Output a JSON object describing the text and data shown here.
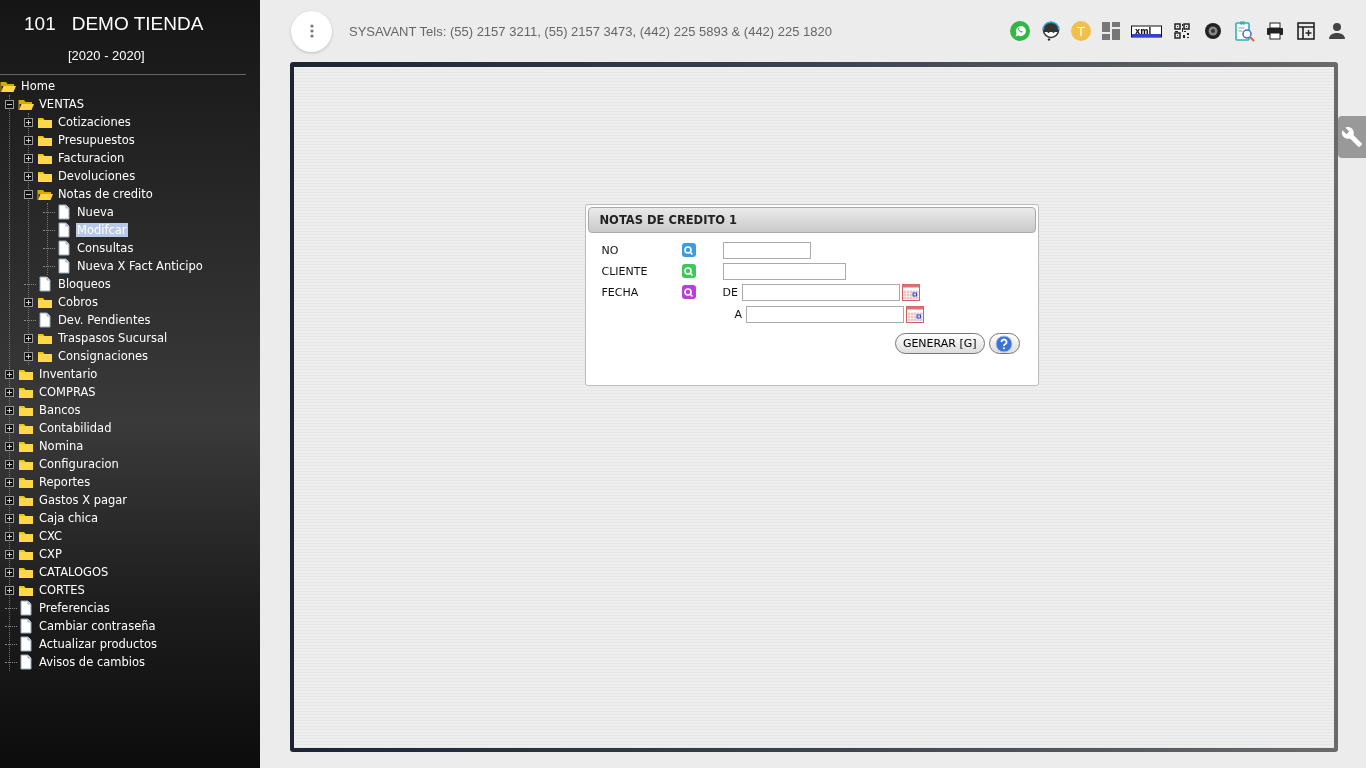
{
  "sidebar": {
    "company_number": "101",
    "company_name": "DEMO TIENDA",
    "period": "[2020 - 2020]",
    "tree": [
      {
        "label": "Home",
        "kind": "folder",
        "expanded": true,
        "selected": false,
        "children": [
          {
            "label": "VENTAS",
            "kind": "folder",
            "expanded": true,
            "selected": false,
            "children": [
              {
                "label": "Cotizaciones",
                "kind": "folder",
                "expanded": false,
                "selected": false
              },
              {
                "label": "Presupuestos",
                "kind": "folder",
                "expanded": false,
                "selected": false
              },
              {
                "label": "Facturacion",
                "kind": "folder",
                "expanded": false,
                "selected": false
              },
              {
                "label": "Devoluciones",
                "kind": "folder",
                "expanded": false,
                "selected": false
              },
              {
                "label": "Notas de credito",
                "kind": "folder",
                "expanded": true,
                "selected": false,
                "children": [
                  {
                    "label": "Nueva",
                    "kind": "page",
                    "selected": false
                  },
                  {
                    "label": "Modifcar",
                    "kind": "page",
                    "selected": true
                  },
                  {
                    "label": "Consultas",
                    "kind": "page",
                    "selected": false
                  },
                  {
                    "label": "Nueva X Fact Anticipo",
                    "kind": "page",
                    "selected": false
                  }
                ]
              },
              {
                "label": "Bloqueos",
                "kind": "page",
                "selected": false
              },
              {
                "label": "Cobros",
                "kind": "folder",
                "expanded": false,
                "selected": false
              },
              {
                "label": "Dev. Pendientes",
                "kind": "page",
                "selected": false
              },
              {
                "label": "Traspasos Sucursal",
                "kind": "folder",
                "expanded": false,
                "selected": false
              },
              {
                "label": "Consignaciones",
                "kind": "folder",
                "expanded": false,
                "selected": false
              }
            ]
          },
          {
            "label": "Inventario",
            "kind": "folder",
            "expanded": false,
            "selected": false
          },
          {
            "label": "COMPRAS",
            "kind": "folder",
            "expanded": false,
            "selected": false
          },
          {
            "label": "Bancos",
            "kind": "folder",
            "expanded": false,
            "selected": false
          },
          {
            "label": "Contabilidad",
            "kind": "folder",
            "expanded": false,
            "selected": false
          },
          {
            "label": "Nomina",
            "kind": "folder",
            "expanded": false,
            "selected": false
          },
          {
            "label": "Configuracion",
            "kind": "folder",
            "expanded": false,
            "selected": false
          },
          {
            "label": "Reportes",
            "kind": "folder",
            "expanded": false,
            "selected": false
          },
          {
            "label": "Gastos X pagar",
            "kind": "folder",
            "expanded": false,
            "selected": false
          },
          {
            "label": "Caja chica",
            "kind": "folder",
            "expanded": false,
            "selected": false
          },
          {
            "label": "CXC",
            "kind": "folder",
            "expanded": false,
            "selected": false
          },
          {
            "label": "CXP",
            "kind": "folder",
            "expanded": false,
            "selected": false
          },
          {
            "label": "CATALOGOS",
            "kind": "folder",
            "expanded": false,
            "selected": false
          },
          {
            "label": "CORTES",
            "kind": "folder",
            "expanded": false,
            "selected": false
          },
          {
            "label": "Preferencias",
            "kind": "page",
            "selected": false
          },
          {
            "label": "Cambiar contraseña",
            "kind": "page",
            "selected": false
          },
          {
            "label": "Actualizar productos",
            "kind": "page",
            "selected": false
          },
          {
            "label": "Avisos de cambios",
            "kind": "page",
            "selected": false
          }
        ]
      }
    ]
  },
  "topbar": {
    "info": "SYSAVANT Tels: (55) 2157 3211, (55) 2157 3473, (442) 225 5893 & (442) 225 1820",
    "tools": [
      {
        "kind": "whatsapp"
      },
      {
        "kind": "support"
      },
      {
        "kind": "letter",
        "text": "T"
      },
      {
        "kind": "grid"
      },
      {
        "kind": "xml"
      },
      {
        "kind": "qr"
      },
      {
        "kind": "tire"
      },
      {
        "kind": "report"
      },
      {
        "kind": "print"
      },
      {
        "kind": "table"
      },
      {
        "kind": "user"
      }
    ]
  },
  "dialog": {
    "title": "NOTAS DE CREDITO 1",
    "fields": [
      {
        "label": "NO",
        "kind": "text",
        "color": "#3d9be0"
      },
      {
        "label": "CLIENTE",
        "kind": "text",
        "color": "#3cc85a"
      },
      {
        "label": "FECHA",
        "kind": "range",
        "color": "#b83ee0",
        "from_label": "DE",
        "to_label": "A"
      }
    ],
    "generate_button": "GENERAR [G]"
  }
}
